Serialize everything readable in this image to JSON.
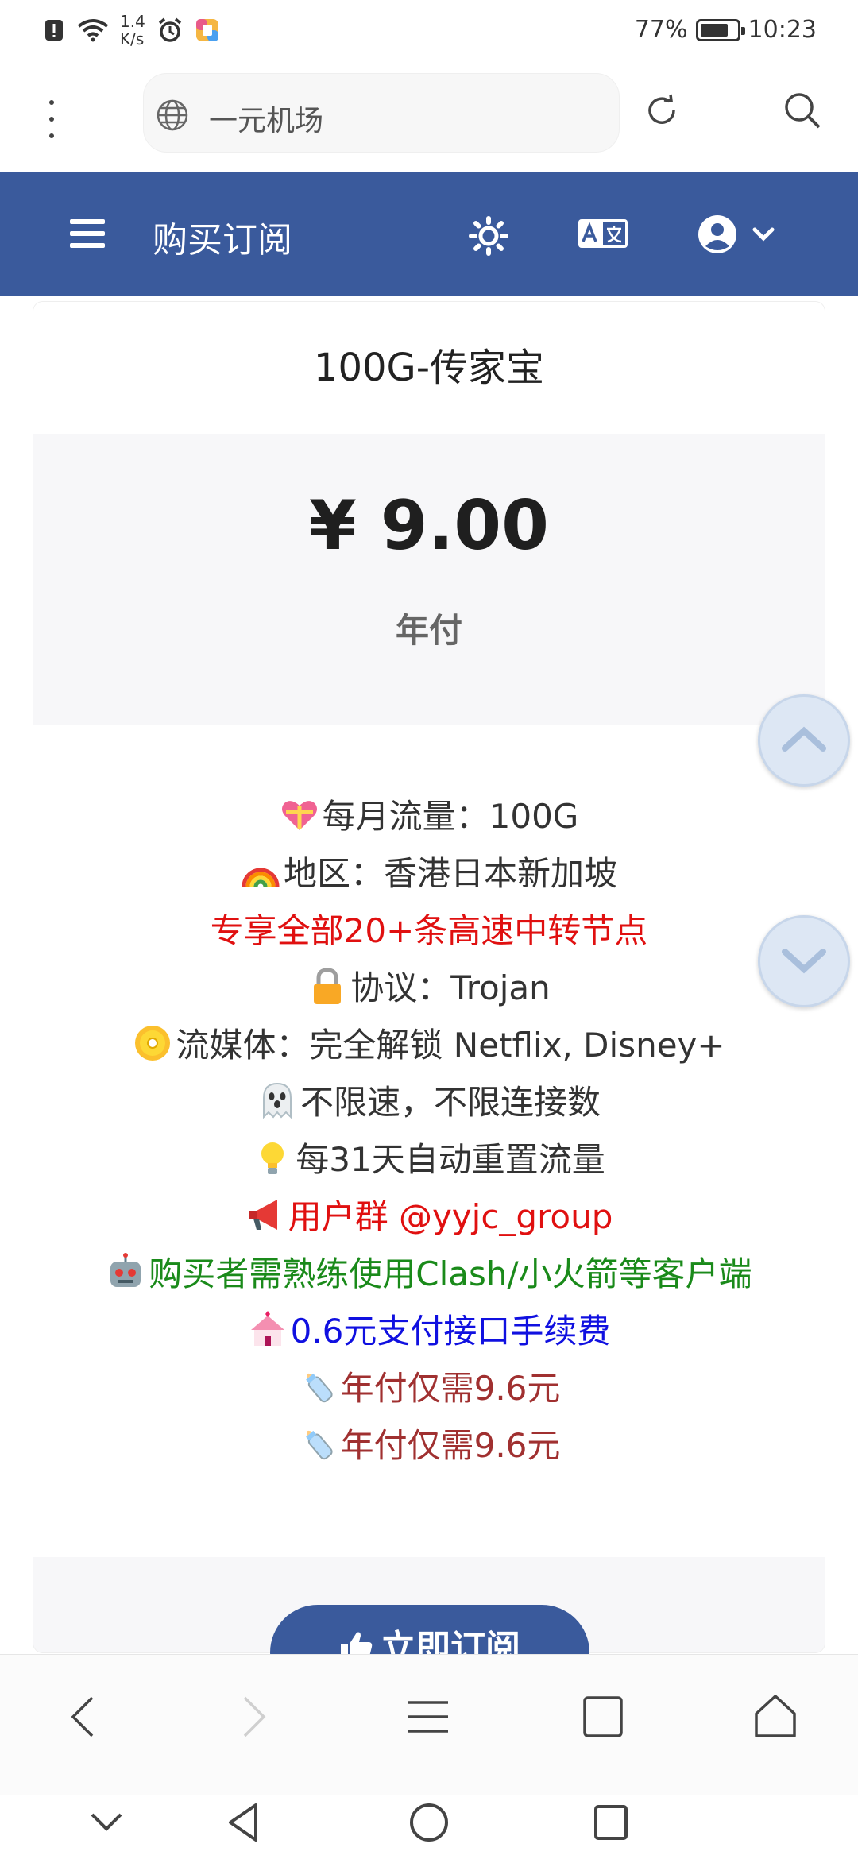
{
  "status_bar": {
    "net_speed_value": "1.4",
    "net_speed_unit": "K/s",
    "battery": "77%",
    "battery_level": 0.77,
    "time": "10:23"
  },
  "browser": {
    "url_text": "一元机场",
    "icons": [
      "more-vert-icon",
      "globe-icon",
      "reload-icon",
      "search-icon"
    ]
  },
  "header": {
    "title": "购买订阅",
    "background": "#3a5a9c",
    "icons": [
      "menu-icon",
      "theme-sun-icon",
      "translate-icon",
      "user-avatar-icon",
      "chevron-down-icon"
    ]
  },
  "plan": {
    "name": "100G-传家宝",
    "price": "¥ 9.00",
    "period": "年付",
    "features": [
      {
        "emoji": "gift-heart-icon",
        "text": "每月流量：100G",
        "color": "#333333"
      },
      {
        "emoji": "rainbow-icon",
        "text": "地区：香港日本新加坡",
        "color": "#333333"
      },
      {
        "emoji": "",
        "text": "专享全部20+条高速中转节点",
        "color": "#e01010"
      },
      {
        "emoji": "lock-icon",
        "text": "协议：Trojan",
        "color": "#333333"
      },
      {
        "emoji": "dvd-icon",
        "text": "流媒体：完全解锁 Netflix, Disney+",
        "color": "#333333"
      },
      {
        "emoji": "ghost-icon",
        "text": "不限速，不限连接数",
        "color": "#333333"
      },
      {
        "emoji": "lightbulb-icon",
        "text": "每31天自动重置流量",
        "color": "#333333"
      },
      {
        "emoji": "megaphone-icon",
        "text": "用户群 @yyjc_group",
        "color": "#e01010"
      },
      {
        "emoji": "robot-icon",
        "text": "购买者需熟练使用Clash/小火箭等客户端",
        "color": "#1a8a1a"
      },
      {
        "emoji": "wedding-icon",
        "text": "0.6元支付接口手续费",
        "color": "#1010e0"
      },
      {
        "emoji": "baby-bottle-icon",
        "text": "年付仅需9.6元",
        "color": "#a03030"
      },
      {
        "emoji": "baby-bottle-icon",
        "text": "年付仅需9.6元",
        "color": "#a03030"
      }
    ],
    "subscribe_label": "立即订阅"
  },
  "scroll_buttons": {
    "up": "scroll-up-icon",
    "down": "scroll-down-icon"
  },
  "browser_toolbar": [
    "back-icon",
    "forward-icon",
    "menu-lines-icon",
    "tabs-icon",
    "home-icon"
  ],
  "system_nav": [
    "hide-keyboard-icon",
    "nav-back-icon",
    "nav-home-icon",
    "nav-recents-icon"
  ]
}
